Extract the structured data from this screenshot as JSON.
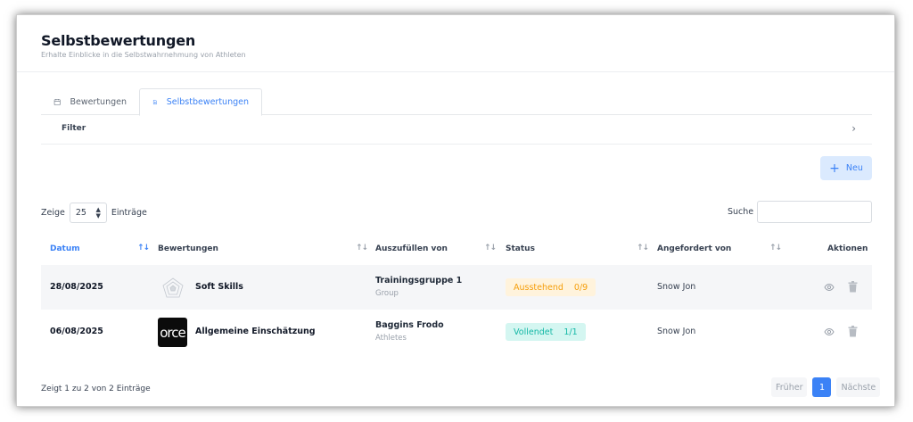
{
  "header": {
    "title": "Selbstbewertungen",
    "subtitle": "Erhalte Einblicke in die Selbstwahrnehmung von Athleten"
  },
  "tabs": [
    {
      "label": "Bewertungen",
      "icon": "calendar-icon",
      "active": false
    },
    {
      "label": "Selbstbewertungen",
      "icon": "document-icon",
      "active": true
    }
  ],
  "filter": {
    "label": "Filter",
    "icon": "chevron-right-icon"
  },
  "toolbar": {
    "new_label": "Neu",
    "new_icon": "plus-icon"
  },
  "length": {
    "prefix": "Zeige",
    "value": "25",
    "suffix": "Einträge"
  },
  "search": {
    "label": "Suche",
    "value": ""
  },
  "table": {
    "columns": [
      {
        "label": "Datum",
        "active": true
      },
      {
        "label": "Bewertungen"
      },
      {
        "label": "Auszufüllen von"
      },
      {
        "label": "Status"
      },
      {
        "label": "Angefordert von"
      },
      {
        "label": "Aktionen"
      }
    ],
    "rows": [
      {
        "date": "28/08/2025",
        "evaluation": "Soft Skills",
        "thumb": "radar-chart-icon",
        "fill_main": "Trainingsgruppe 1",
        "fill_sub": "Group",
        "status_label": "Ausstehend",
        "status_count": "0/9",
        "status_color": "#f59e0b",
        "requested_by": "Snow Jon"
      },
      {
        "date": "06/08/2025",
        "evaluation": "Allgemeine Einschätzung",
        "thumb_text": "orce",
        "fill_main": "Baggins Frodo",
        "fill_sub": "Athletes",
        "status_label": "Vollendet",
        "status_count": "1/1",
        "status_color": "#14b8a6",
        "requested_by": "Snow Jon"
      }
    ]
  },
  "footer": {
    "info": "Zeigt 1 zu 2 von 2 Einträge",
    "prev": "Früher",
    "current": "1",
    "next": "Nächste"
  },
  "colors": {
    "accent": "#3b82f6",
    "pending": "#f59e0b",
    "done": "#14b8a6"
  }
}
